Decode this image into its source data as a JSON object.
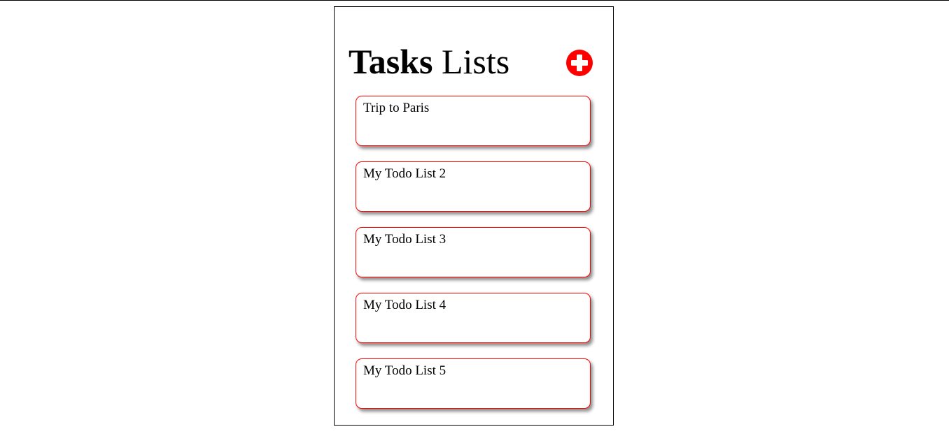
{
  "header": {
    "title_bold": "Tasks",
    "title_rest": " Lists",
    "add_icon": "plus-circle-icon"
  },
  "lists": [
    {
      "label": "Trip to Paris"
    },
    {
      "label": "My Todo List 2"
    },
    {
      "label": "My Todo List 3"
    },
    {
      "label": "My Todo List 4"
    },
    {
      "label": "My Todo List 5"
    }
  ],
  "colors": {
    "accent": "#ff0000",
    "text": "#000000",
    "background": "#ffffff"
  }
}
